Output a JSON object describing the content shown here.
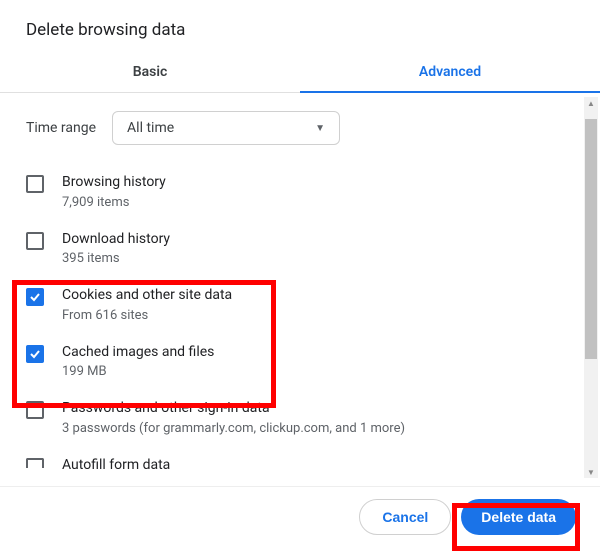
{
  "dialog": {
    "title": "Delete browsing data"
  },
  "tabs": {
    "basic": "Basic",
    "advanced": "Advanced"
  },
  "time": {
    "label": "Time range",
    "selected": "All time"
  },
  "items": [
    {
      "title": "Browsing history",
      "sub": "7,909 items",
      "checked": false
    },
    {
      "title": "Download history",
      "sub": "395 items",
      "checked": false
    },
    {
      "title": "Cookies and other site data",
      "sub": "From 616 sites",
      "checked": true
    },
    {
      "title": "Cached images and files",
      "sub": "199 MB",
      "checked": true
    },
    {
      "title": "Passwords and other sign-in data",
      "sub": "3 passwords (for grammarly.com, clickup.com, and 1 more)",
      "checked": false
    },
    {
      "title": "Autofill form data",
      "sub": "",
      "checked": false
    }
  ],
  "footer": {
    "cancel": "Cancel",
    "delete": "Delete data"
  }
}
